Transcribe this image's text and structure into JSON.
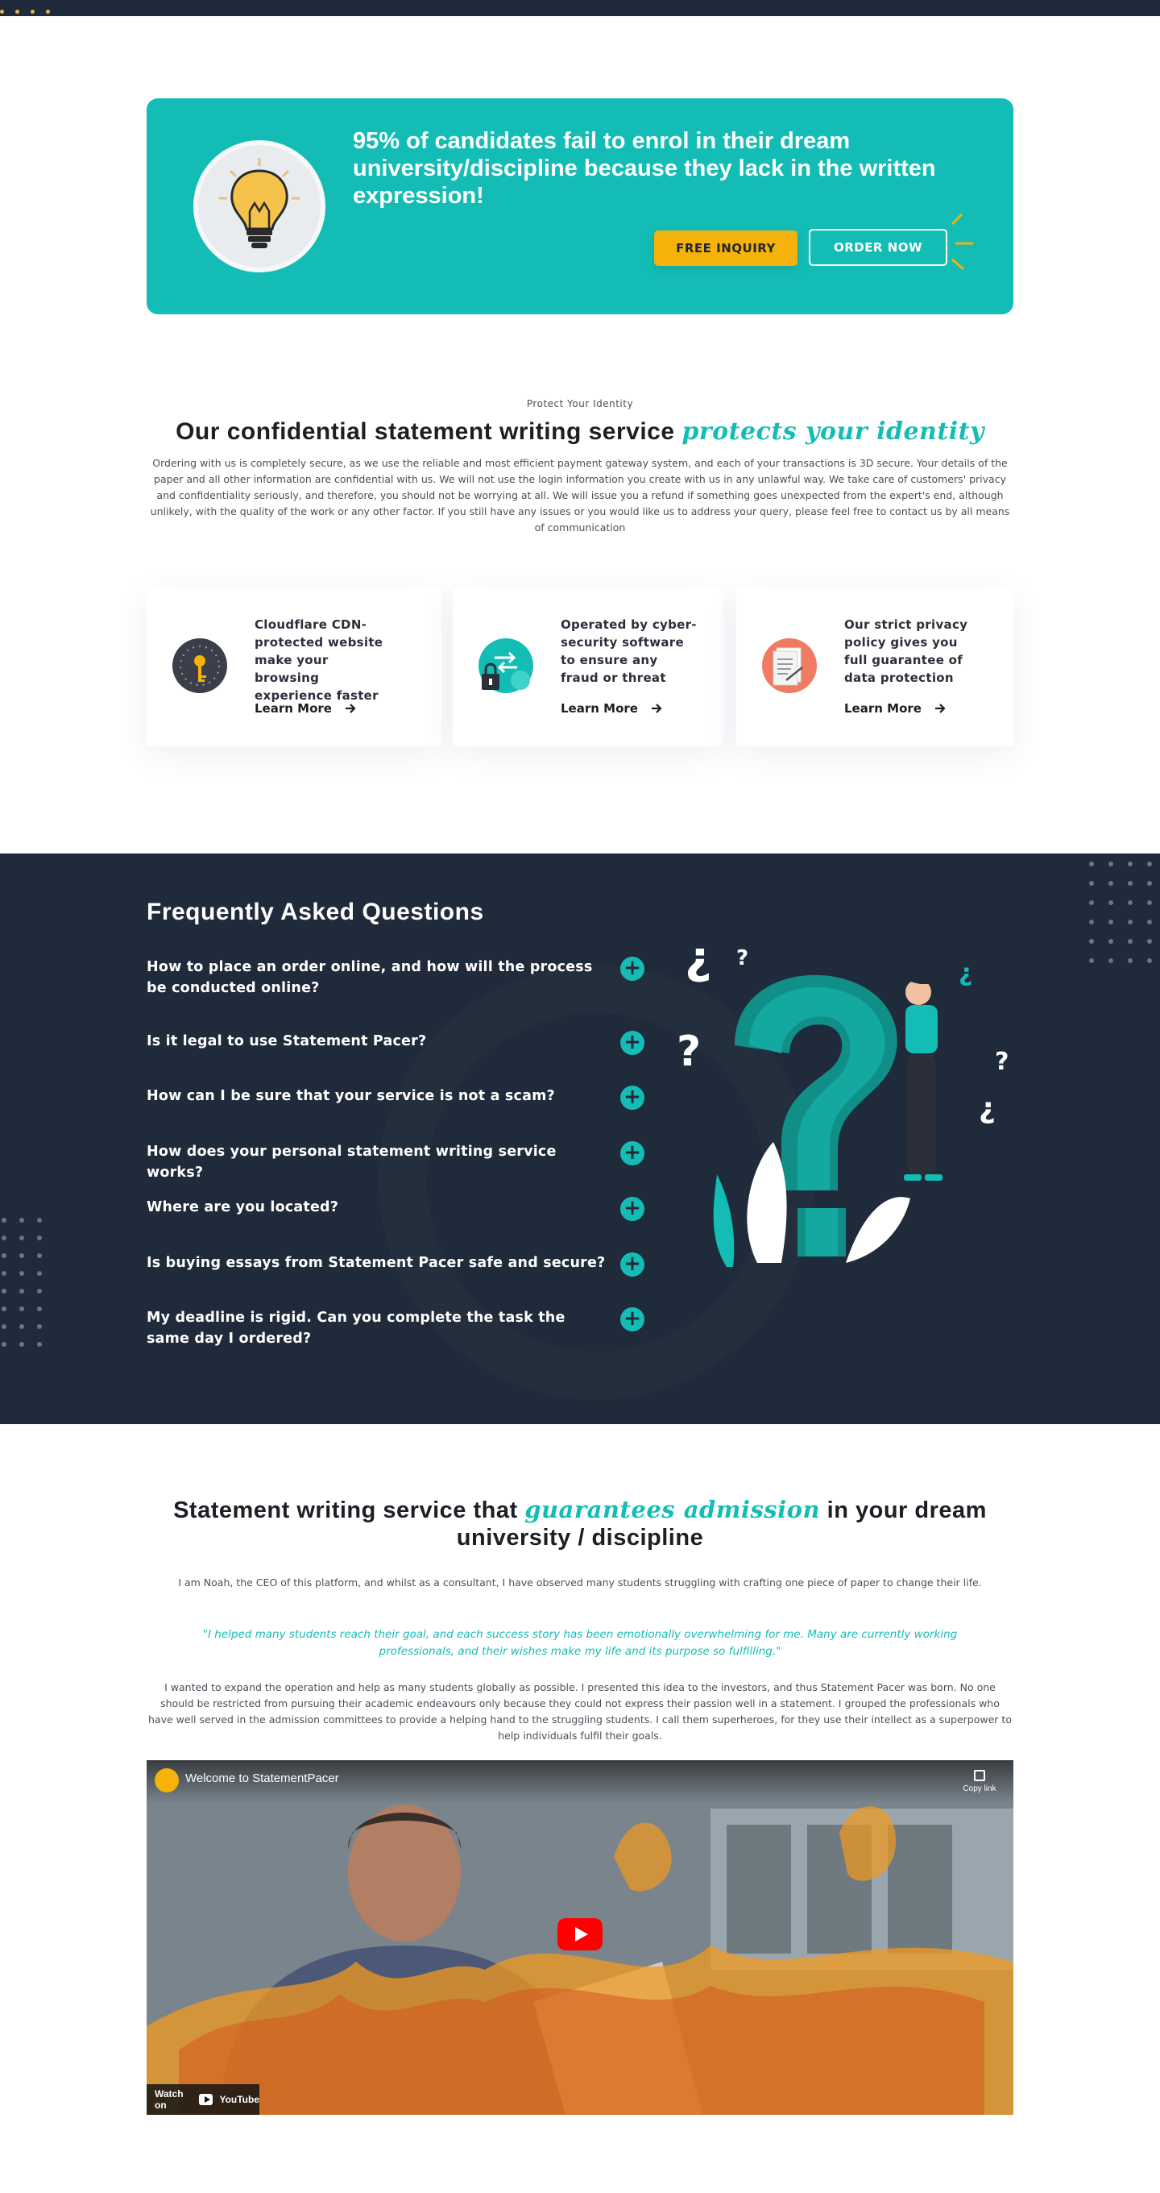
{
  "banner": {
    "title": "95% of candidates fail to enrol in their dream university/discipline because they lack in the written expression!",
    "free_inquiry_label": "FREE INQUIRY",
    "order_now_label": "ORDER NOW"
  },
  "identity": {
    "eyebrow": "Protect Your Identity",
    "title_main": "Our confidential statement writing service ",
    "title_script": "protects your identity",
    "description": "Ordering with us is completely secure, as we use the reliable and most efficient payment gateway system, and each of your transactions is 3D secure. Your details of the paper and all other information are confidential with us. We will not use the login information you create with us in any unlawful way. We take care of customers' privacy and confidentiality seriously, and therefore, you should not be worrying at all. We will issue you a refund if something goes unexpected from the expert's end, although unlikely, with the quality of the work or any other factor. If you still have any issues or you would like us to address your query, please feel free to contact us by all means of communication",
    "cards": [
      {
        "text": "Cloudflare CDN-protected website make your browsing experience faster",
        "link": "Learn More",
        "icon": "key-clock-icon"
      },
      {
        "text": "Operated by cyber-security software to ensure any fraud or threat",
        "link": "Learn More",
        "icon": "security-lock-icon"
      },
      {
        "text": "Our strict privacy policy gives you full guarantee of data protection",
        "link": "Learn More",
        "icon": "document-policy-icon"
      }
    ]
  },
  "faq": {
    "title": "Frequently Asked Questions",
    "items": [
      "How to place an order online, and how will the process be conducted online?",
      "Is it legal to use Statement Pacer?",
      "How can I be sure that your service is not a scam?",
      "How does your personal statement writing service works?",
      "Where are you located?",
      "Is buying essays from Statement Pacer safe and secure?",
      "My deadline is rigid. Can you complete the task the same day I ordered?"
    ]
  },
  "admission": {
    "title_before": "Statement writing service that ",
    "title_script": "guarantees admission",
    "title_after": " in your dream university / discipline",
    "intro": "I am Noah, the CEO of this platform, and whilst as a consultant, I have observed many students struggling with crafting one piece of paper to change their life.",
    "quote": "\"I helped many students reach their goal, and each success story has been emotionally overwhelming for me. Many are currently working professionals, and their wishes make my life and its purpose so fulfilling.\"",
    "story": "I wanted to expand the operation and help as many students globally as possible. I presented this idea to the investors, and thus Statement Pacer was born. No one should be restricted from pursuing their academic endeavours only because they could not express their passion well in a statement. I grouped the professionals who have well served in the admission committees to provide a helping hand to the struggling students. I call them superheroes, for they use their intellect as a superpower to help individuals fulfil their goals."
  },
  "video": {
    "title": "Welcome to StatementPacer",
    "copy_link": "Copy link",
    "watch_on": "Watch on",
    "platform": "YouTube"
  },
  "colors": {
    "accent": "#13bdb5",
    "dark_bg": "#1f2a3a",
    "cta_yellow": "#f4b20a"
  }
}
